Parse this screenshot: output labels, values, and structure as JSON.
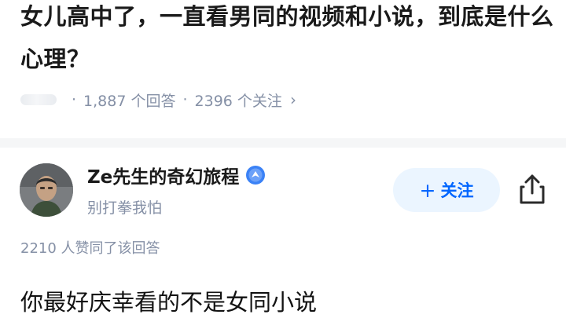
{
  "question": {
    "title": "女儿高中了，一直看男同的视频和小说，到底是什么心理？",
    "answer_count": "1,887 个回答",
    "follower_count": "2396 个关注",
    "separator": "·",
    "chevron": "›"
  },
  "answer": {
    "author_name": "Ze先生的奇幻旅程",
    "author_bio": "别打拳我怕",
    "follow_label": "关注",
    "follow_plus": "+",
    "likes_text": "2210 人赞同了该回答",
    "first_line": "你最好庆幸看的不是女同小说"
  },
  "colors": {
    "accent": "#0066ff",
    "follow_bg": "#ebf5ff",
    "secondary_text": "#8590a6",
    "divider": "#f5f6f7"
  },
  "icons": {
    "badge": "verified-badge-icon",
    "share": "share-icon"
  }
}
